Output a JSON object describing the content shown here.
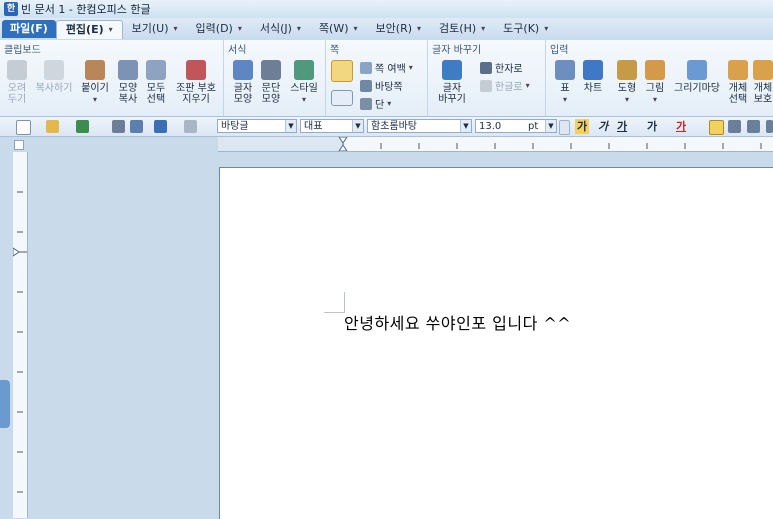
{
  "window": {
    "title": "빈 문서 1 - 한컴오피스 한글",
    "app_icon_glyph": "한"
  },
  "menu": {
    "file": "파일(F)",
    "items": [
      {
        "label": "편집(E)",
        "active": true
      },
      {
        "label": "보기(U)"
      },
      {
        "label": "입력(D)"
      },
      {
        "label": "서식(J)"
      },
      {
        "label": "쪽(W)"
      },
      {
        "label": "보안(R)"
      },
      {
        "label": "검토(H)"
      },
      {
        "label": "도구(K)"
      }
    ]
  },
  "ribbon": {
    "groups": {
      "clipboard": "클립보드",
      "format": "서식",
      "page": "쪽",
      "convert": "글자 바꾸기",
      "input": "입력"
    },
    "clipboard": {
      "cut": "오려\n두기",
      "copy": "복사하기",
      "paste": "붙이기",
      "shape_copy": "모양\n복사",
      "select_all": "모두\n선택",
      "clear_marks": "조판 부호\n지우기"
    },
    "format": {
      "char_shape": "글자\n모양",
      "para_shape": "문단\n모양",
      "style": "스타일"
    },
    "page": {
      "page_margin": "쪽 여백",
      "page_bg": "바탕쪽",
      "column": "단"
    },
    "convert": {
      "char_convert": "글자\n바꾸기",
      "hanja": "한자로",
      "hangul": "한글로"
    },
    "input": {
      "table": "표",
      "chart": "차트",
      "shape": "도형",
      "picture": "그림",
      "draw_market": "그리기마당",
      "obj_select": "개체\n선택",
      "obj_protect": "개체\n보호"
    }
  },
  "format_toolbar": {
    "style_combo": "바탕글",
    "language_combo": "대표",
    "font_combo": "함초롬바탕",
    "size_combo": "13.0",
    "size_unit": "pt",
    "bold": "가",
    "italic": "가",
    "underline": "가",
    "strike": "가",
    "color": "가"
  },
  "document": {
    "body_text": "안녕하세요 쑤야인포 입니다 ^^"
  }
}
